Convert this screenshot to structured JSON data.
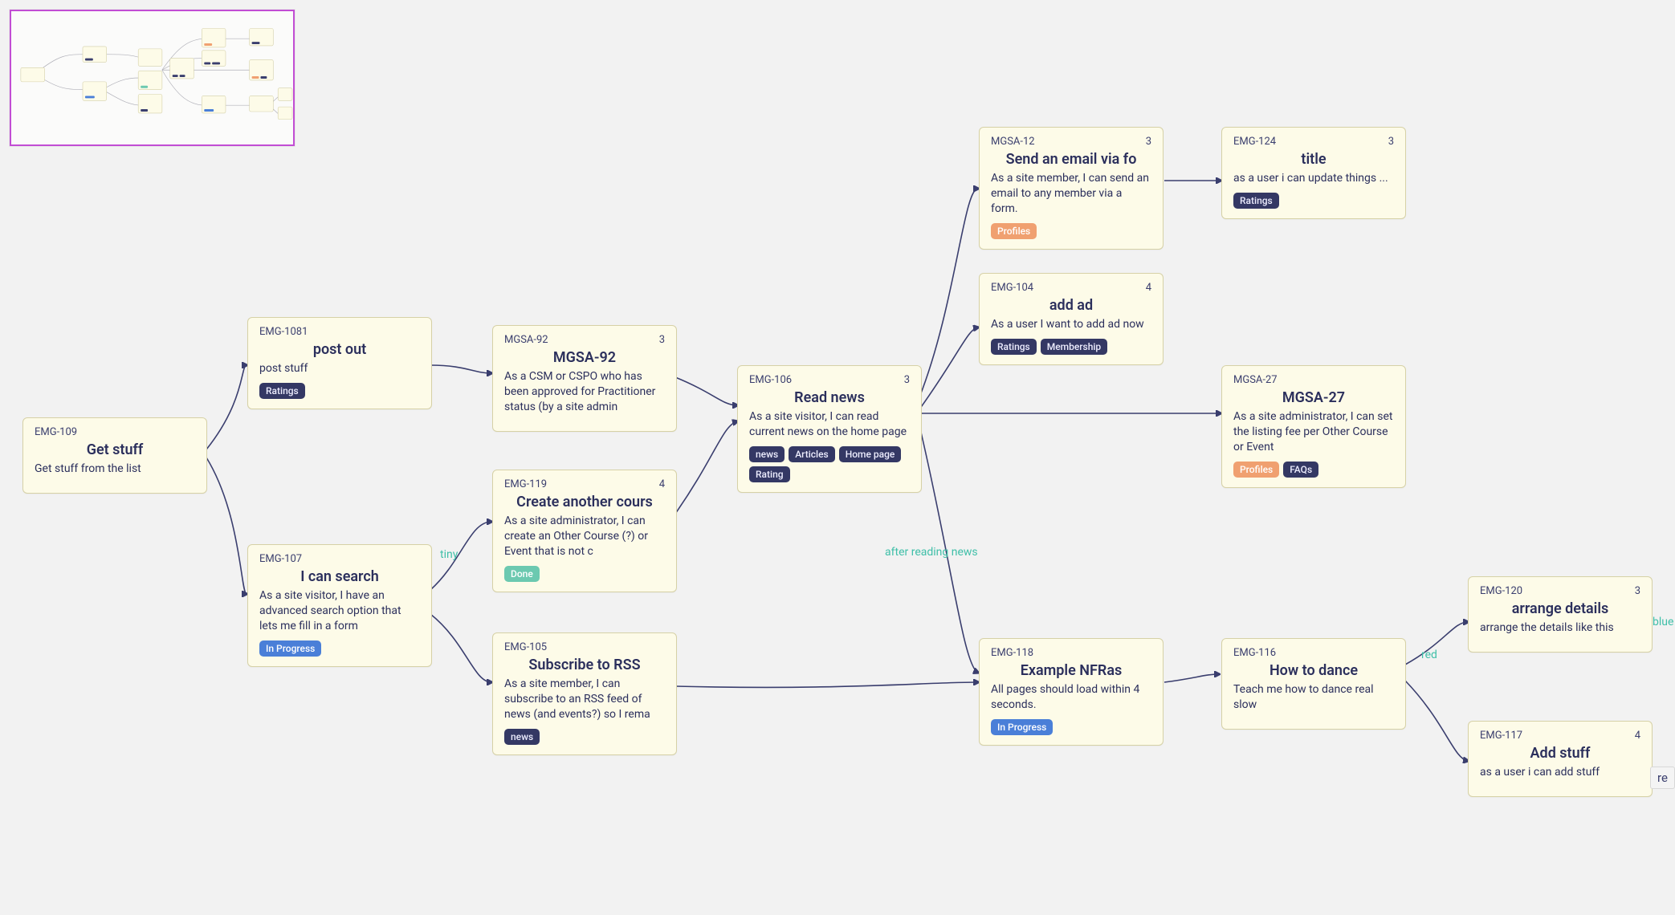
{
  "nodes": {
    "n109": {
      "id": "EMG-109",
      "title": "Get stuff",
      "desc": "Get stuff from the list",
      "points": "",
      "tags": []
    },
    "n1081": {
      "id": "EMG-1081",
      "title": "post out",
      "desc": "post stuff",
      "points": "",
      "tags": [
        {
          "text": "Ratings",
          "color": "dark"
        }
      ]
    },
    "n107": {
      "id": "EMG-107",
      "title": "I can search",
      "desc": "As a site visitor, I have an advanced search option that lets me fill in a form",
      "points": "",
      "tags": [
        {
          "text": "In Progress",
          "color": "blue"
        }
      ]
    },
    "n92": {
      "id": "MGSA-92",
      "title": "MGSA-92",
      "desc": "As a CSM or CSPO who has been approved for Practitioner status (by a site admin",
      "points": "3",
      "tags": []
    },
    "n119": {
      "id": "EMG-119",
      "title": "Create another cours",
      "desc": "As a site administrator, I can create an Other Course (?) or Event that is not c",
      "points": "4",
      "tags": [
        {
          "text": "Done",
          "color": "green"
        }
      ]
    },
    "n105": {
      "id": "EMG-105",
      "title": "Subscribe to RSS",
      "desc": "As a site member, I can subscribe to an RSS feed of news (and events?) so I rema",
      "points": "",
      "tags": [
        {
          "text": "news",
          "color": "dark"
        }
      ]
    },
    "n106": {
      "id": "EMG-106",
      "title": "Read news",
      "desc": "As a site visitor, I can read current news on the home page",
      "points": "3",
      "tags": [
        {
          "text": "news",
          "color": "dark"
        },
        {
          "text": "Articles",
          "color": "dark"
        },
        {
          "text": "Home page",
          "color": "dark"
        },
        {
          "text": "Rating",
          "color": "dark"
        }
      ]
    },
    "n12": {
      "id": "MGSA-12",
      "title": "Send an email via fo",
      "desc": "As a site member, I can send an email to any member via a form.",
      "points": "3",
      "tags": [
        {
          "text": "Profiles",
          "color": "orange"
        }
      ]
    },
    "n124": {
      "id": "EMG-124",
      "title": "title",
      "desc": "as a user i can update things ...",
      "points": "3",
      "tags": [
        {
          "text": "Ratings",
          "color": "dark"
        }
      ]
    },
    "n104": {
      "id": "EMG-104",
      "title": "add ad",
      "desc": "As a user I want to add ad now",
      "points": "4",
      "tags": [
        {
          "text": "Ratings",
          "color": "dark"
        },
        {
          "text": "Membership",
          "color": "dark"
        }
      ]
    },
    "n27": {
      "id": "MGSA-27",
      "title": "MGSA-27",
      "desc": "As a site administrator, I can set the listing fee per Other Course or Event",
      "points": "",
      "tags": [
        {
          "text": "Profiles",
          "color": "orange"
        },
        {
          "text": "FAQs",
          "color": "dark"
        }
      ]
    },
    "n118": {
      "id": "EMG-118",
      "title": "Example NFRas",
      "desc": "All pages should load within 4 seconds.",
      "points": "",
      "tags": [
        {
          "text": "In Progress",
          "color": "blue"
        }
      ]
    },
    "n116": {
      "id": "EMG-116",
      "title": "How to dance",
      "desc": "Teach me how to dance real slow",
      "points": "",
      "tags": []
    },
    "n120": {
      "id": "EMG-120",
      "title": "arrange details",
      "desc": "arrange the details like this",
      "points": "3",
      "tags": []
    },
    "n117": {
      "id": "EMG-117",
      "title": "Add stuff",
      "desc": "as a user i can add stuff",
      "points": "4",
      "tags": []
    }
  },
  "edge_labels": {
    "tiny": "tiny",
    "after": "after reading news",
    "red": "red",
    "blue": "blue"
  },
  "loose_label": "re"
}
